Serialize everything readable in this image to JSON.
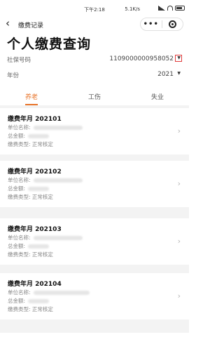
{
  "status_bar": {
    "time": "下午2:18",
    "network_speed": "5.1K/s"
  },
  "nav": {
    "back_label": "‹",
    "title": "缴费记录",
    "more_label": "•••"
  },
  "page_title": "个人缴费查询",
  "fields": {
    "ssn": {
      "label": "社保号码",
      "value": "1109000000958052"
    },
    "year": {
      "label": "年份",
      "value": "2021"
    }
  },
  "tabs": [
    {
      "label": "养老",
      "active": true
    },
    {
      "label": "工伤",
      "active": false
    },
    {
      "label": "失业",
      "active": false
    }
  ],
  "records": [
    {
      "month": "缴费年月 202101",
      "unit_label": "单位名称:",
      "amount_label": "总金额:",
      "type_label": "缴费类型: 正常核定"
    },
    {
      "month": "缴费年月 202102",
      "unit_label": "单位名称:",
      "amount_label": "总金额:",
      "type_label": "缴费类型: 正常核定"
    },
    {
      "month": "缴费年月 202103",
      "unit_label": "单位名称:",
      "amount_label": "总金额:",
      "type_label": "缴费类型: 正常核定"
    },
    {
      "month": "缴费年月 202104",
      "unit_label": "单位名称:",
      "amount_label": "总金额:",
      "type_label": "缴费类型: 正常核定"
    }
  ],
  "colors": {
    "accent": "#e8742a",
    "highlight_box": "#e03a3a"
  }
}
